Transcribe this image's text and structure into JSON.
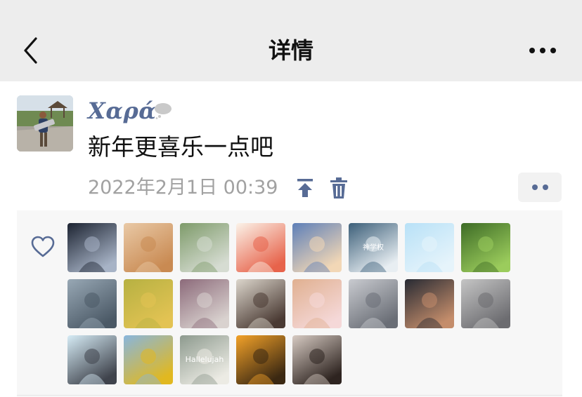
{
  "nav": {
    "title": "详情",
    "back_icon": "chevron-left-icon",
    "more_icon": "more-horizontal-icon"
  },
  "post": {
    "author": "Χαρά",
    "text": "新年更喜乐一点吧",
    "time": "2022年2月1日 00:39",
    "pin_icon": "pin-to-top-icon",
    "delete_icon": "trash-icon",
    "actions_icon": "more-dots-icon"
  },
  "likes": {
    "icon": "heart-outline-icon",
    "avatars": [
      {
        "name": "like-avatar-night-figure",
        "colors": [
          "#1c2331",
          "#a7b3c6"
        ]
      },
      {
        "name": "like-avatar-pomeranian-dog",
        "colors": [
          "#e9c9a6",
          "#c98a52"
        ]
      },
      {
        "name": "like-avatar-park-sign",
        "colors": [
          "#7e9b6a",
          "#d6dcd2"
        ]
      },
      {
        "name": "like-avatar-bunny-carrot",
        "colors": [
          "#fbf3e9",
          "#e7634b"
        ]
      },
      {
        "name": "like-avatar-cartoon-sheep",
        "colors": [
          "#5d7fb8",
          "#f2d7b6"
        ]
      },
      {
        "name": "like-avatar-blue-text-card",
        "colors": [
          "#3c5f79",
          "#e8eef2"
        ]
      },
      {
        "name": "like-avatar-sky-text-card",
        "colors": [
          "#b8e1f7",
          "#e6f4fb"
        ]
      },
      {
        "name": "like-avatar-green-path",
        "colors": [
          "#3d6b26",
          "#9bcc5c"
        ]
      },
      {
        "name": "like-avatar-city-street",
        "colors": [
          "#98a8b5",
          "#4b5966"
        ]
      },
      {
        "name": "like-avatar-autumn-trees",
        "colors": [
          "#b6b142",
          "#e3c353"
        ]
      },
      {
        "name": "like-avatar-dog-flowers",
        "colors": [
          "#8c6a7a",
          "#d9d2cf"
        ]
      },
      {
        "name": "like-avatar-girl-back",
        "colors": [
          "#dcd6cc",
          "#4a3a33"
        ]
      },
      {
        "name": "like-avatar-bunny-cat",
        "colors": [
          "#e0b090",
          "#f5d8d8"
        ]
      },
      {
        "name": "like-avatar-girl-building",
        "colors": [
          "#c9cbd0",
          "#6a6e76"
        ]
      },
      {
        "name": "like-avatar-smiling-man",
        "colors": [
          "#272a33",
          "#c48d6b"
        ]
      },
      {
        "name": "like-avatar-gray-cat",
        "colors": [
          "#c5c5c5",
          "#6c6c70"
        ]
      },
      {
        "name": "like-avatar-cartoon-cat",
        "colors": [
          "#d6ecf6",
          "#3f434c"
        ]
      },
      {
        "name": "like-avatar-girl-sunflowers",
        "colors": [
          "#88b6de",
          "#e1b820"
        ]
      },
      {
        "name": "like-avatar-hallelujah-sign",
        "colors": [
          "#8d9a8e",
          "#ecebe4"
        ]
      },
      {
        "name": "like-avatar-sunset-bike",
        "colors": [
          "#f3a229",
          "#3b2812"
        ]
      },
      {
        "name": "like-avatar-girl-phone",
        "colors": [
          "#d7cbc3",
          "#2e2420"
        ]
      }
    ],
    "avatar_text": {
      "like-avatar-blue-text-card": "神学权",
      "like-avatar-hallelujah-sign": "Hallelujah"
    }
  },
  "colors": {
    "nav_bg": "#ededed",
    "author_link": "#576b95",
    "meta_gray": "#a1a1a1",
    "panel_bg": "#f7f7f7"
  }
}
